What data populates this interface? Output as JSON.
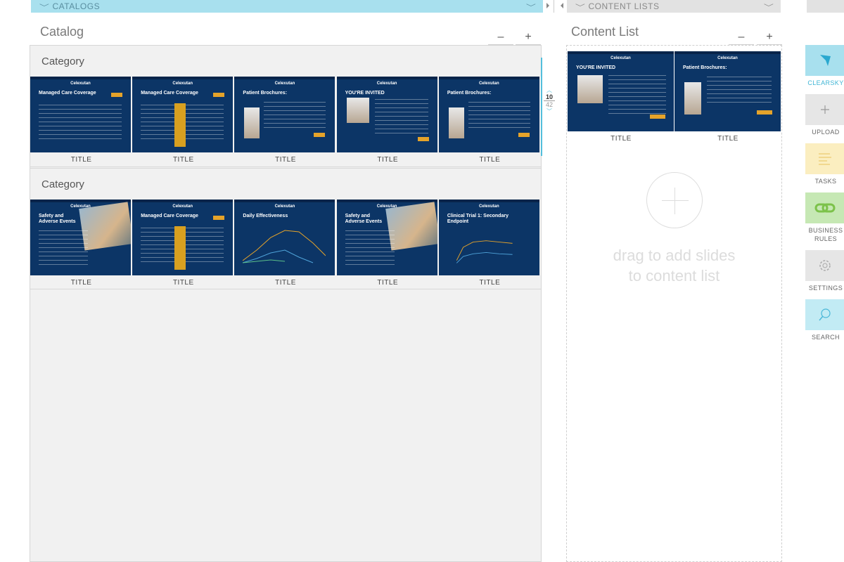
{
  "headers": {
    "catalogs": "CATALOGS",
    "content_lists": "CONTENT LISTS"
  },
  "catalog": {
    "title": "Catalog",
    "minus": "–",
    "plus": "+",
    "categories": [
      {
        "label": "Category",
        "slides": [
          {
            "title": "TITLE",
            "thumb_heading": "Managed Care Coverage"
          },
          {
            "title": "TITLE",
            "thumb_heading": "Managed Care Coverage"
          },
          {
            "title": "TITLE",
            "thumb_heading": "Patient Brochures:"
          },
          {
            "title": "TITLE",
            "thumb_heading": "YOU'RE INVITED"
          },
          {
            "title": "TITLE",
            "thumb_heading": "Patient Brochures:"
          }
        ]
      },
      {
        "label": "Category",
        "slides": [
          {
            "title": "TITLE",
            "thumb_heading": "Safety and Adverse Events"
          },
          {
            "title": "TITLE",
            "thumb_heading": "Managed Care Coverage"
          },
          {
            "title": "TITLE",
            "thumb_heading": "Daily Effectiveness"
          },
          {
            "title": "TITLE",
            "thumb_heading": "Safety and Adverse Events"
          },
          {
            "title": "TITLE",
            "thumb_heading": "Clinical Trial 1: Secondary Endpoint"
          }
        ]
      }
    ],
    "brand": "Celexutan"
  },
  "pager": {
    "current": "10",
    "total": "42"
  },
  "content_list": {
    "title": "Content List",
    "minus": "–",
    "plus": "+",
    "slides": [
      {
        "title": "TITLE",
        "thumb_heading": "YOU'RE INVITED"
      },
      {
        "title": "TITLE",
        "thumb_heading": "Patient Brochures:"
      }
    ],
    "drop_hint_line1": "drag to add slides",
    "drop_hint_line2": "to content list"
  },
  "toolbar": {
    "items": [
      {
        "label": "CLEARSKY",
        "icon": "flag-icon",
        "color": "#a8e0ee"
      },
      {
        "label": "UPLOAD",
        "icon": "plus-icon",
        "color": "#e6e6e6"
      },
      {
        "label": "TASKS",
        "icon": "lines-icon",
        "color": "#fbeec0"
      },
      {
        "label": "BUSINESS",
        "label2": "RULES",
        "icon": "link-icon",
        "color": "#c6e8b4"
      },
      {
        "label": "SETTINGS",
        "icon": "gear-icon",
        "color": "#e6e6e6"
      },
      {
        "label": "SEARCH",
        "icon": "search-icon",
        "color": "#c2ebf4"
      }
    ]
  }
}
